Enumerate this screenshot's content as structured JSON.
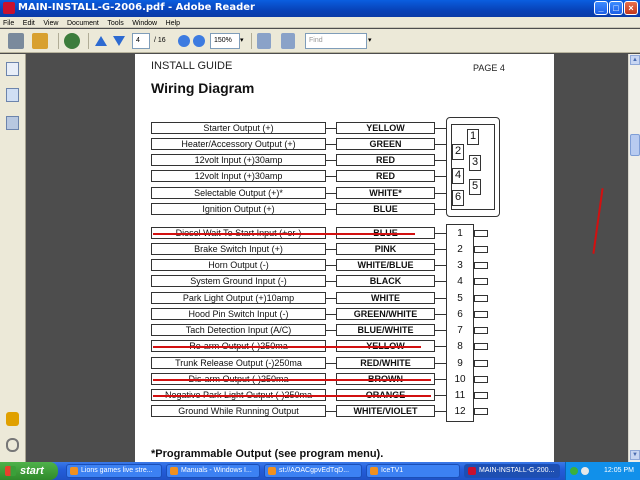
{
  "window": {
    "title": "MAIN-INSTALL-G-2006.pdf - Adobe Reader"
  },
  "menu": [
    "File",
    "Edit",
    "View",
    "Document",
    "Tools",
    "Window",
    "Help"
  ],
  "toolbar": {
    "page_current": "4",
    "page_total": "/ 16",
    "zoom": "150%",
    "find_placeholder": "Find"
  },
  "doc": {
    "header_left": "INSTALL GUIDE",
    "header_right": "PAGE 4",
    "title": "Wiring Diagram",
    "rows": [
      {
        "label": "Starter Output (+)",
        "color": "YELLOW"
      },
      {
        "label": "Heater/Accessory Output (+)",
        "color": "GREEN"
      },
      {
        "label": "12volt Input (+)30amp",
        "color": "RED"
      },
      {
        "label": "12volt Input (+)30amp",
        "color": "RED"
      },
      {
        "label": "Selectable Output (+)*",
        "color": "WHITE*"
      },
      {
        "label": "Ignition Output (+)",
        "color": "BLUE"
      },
      {
        "label": "Diesel Wait To Start Input (+or-)",
        "color": "BLUE"
      },
      {
        "label": "Brake Switch Input (+)",
        "color": "PINK"
      },
      {
        "label": "Horn Output (-)",
        "color": "WHITE/BLUE"
      },
      {
        "label": "System Ground Input (-)",
        "color": "BLACK"
      },
      {
        "label": "Park Light Output (+)10amp",
        "color": "WHITE"
      },
      {
        "label": "Hood Pin Switch Input (-)",
        "color": "GREEN/WHITE"
      },
      {
        "label": "Tach Detection Input (A/C)",
        "color": "BLUE/WHITE"
      },
      {
        "label": "Re-arm Output (-)250ma",
        "color": "YELLOW"
      },
      {
        "label": "Trunk Release Output (-)250ma",
        "color": "RED/WHITE"
      },
      {
        "label": "Dis-arm Output (-)250ma",
        "color": "BROWN"
      },
      {
        "label": "Negative Park Light Output (-)250ma",
        "color": "ORANGE"
      },
      {
        "label": "Ground While Running Output",
        "color": "WHITE/VIOLET"
      }
    ],
    "big_pins": [
      "1",
      "2",
      "3",
      "4",
      "5",
      "6"
    ],
    "small_pins": [
      "1",
      "2",
      "3",
      "4",
      "5",
      "6",
      "7",
      "8",
      "9",
      "10",
      "11",
      "12"
    ],
    "footnote": "*Programmable Output (see program menu)."
  },
  "taskbar": {
    "start": "start",
    "tasks": [
      "Lions games live stre...",
      "Manuals - Windows I...",
      "st://AOACgpvEdTqD...",
      "IceTV1",
      "MAIN-INSTALL-G-200..."
    ],
    "clock": "12:05 PM"
  }
}
